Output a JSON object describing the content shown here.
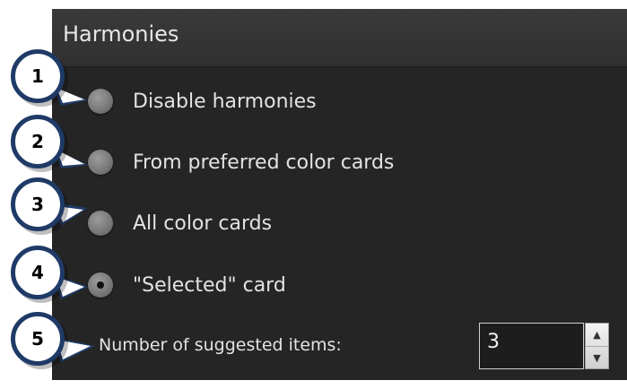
{
  "panel": {
    "title": "Harmonies"
  },
  "options": [
    {
      "label": "Disable harmonies",
      "checked": false
    },
    {
      "label": "From preferred color cards",
      "checked": false
    },
    {
      "label": "All color cards",
      "checked": false
    },
    {
      "label": "\"Selected\" card",
      "checked": true
    }
  ],
  "suggested_items": {
    "label": "Number of suggested items:",
    "value": "3",
    "up_icon": "triangle-up",
    "down_icon": "triangle-down"
  },
  "callouts": [
    "1",
    "2",
    "3",
    "4",
    "5"
  ],
  "colors": {
    "panel_bg": "#252525",
    "header_bg": "#333333",
    "callout_border": "#1f3a66",
    "text": "#e3e3e3"
  }
}
